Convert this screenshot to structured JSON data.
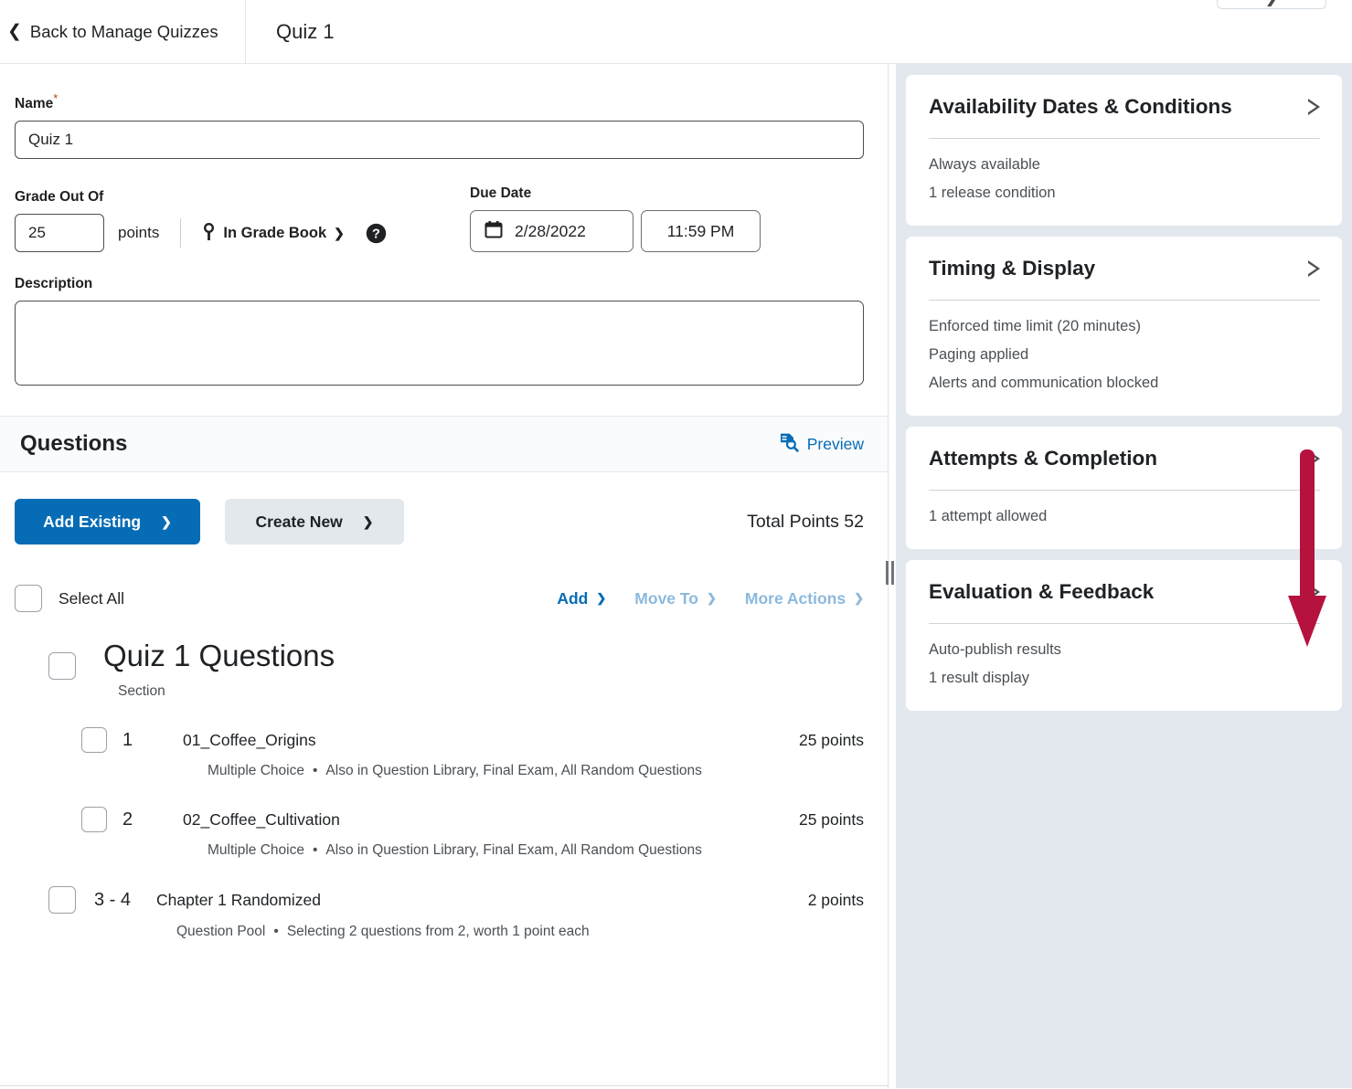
{
  "topbar": {
    "back_label": "Back to Manage Quizzes",
    "back_icon": "chevron-left-icon",
    "doc_title": "Quiz 1",
    "partial_dropdown_icon": "chevron-down-icon"
  },
  "form": {
    "name_label": "Name",
    "name_required_marker": "*",
    "name_value": "Quiz 1",
    "name_placeholder": "",
    "grade_label": "Grade Out Of",
    "grade_value": "25",
    "grade_units": "points",
    "gradebook_icon": "key-icon",
    "gradebook_label": "In Grade Book",
    "gradebook_chevron": "chevron-down-icon",
    "help_icon": "question-circle-icon",
    "due_label": "Due Date",
    "due_date_icon": "calendar-icon",
    "due_date_value": "2/28/2022",
    "due_time_value": "11:59 PM",
    "description_label": "Description",
    "description_value": "",
    "description_placeholder": ""
  },
  "questions": {
    "heading": "Questions",
    "preview_label": "Preview",
    "preview_icon": "document-search-icon",
    "add_existing_label": "Add Existing",
    "create_new_label": "Create New",
    "dropdown_icon": "chevron-down-icon",
    "total_points_label": "Total Points 52",
    "select_all_label": "Select All",
    "tools": [
      {
        "label": "Add",
        "state": "enabled"
      },
      {
        "label": "Move To",
        "state": "disabled"
      },
      {
        "label": "More Actions",
        "state": "disabled"
      }
    ],
    "section": {
      "title": "Quiz 1 Questions",
      "subtitle": "Section"
    },
    "items": [
      {
        "number": "1",
        "name": "01_Coffee_Origins",
        "points": "25 points",
        "type": "Multiple Choice",
        "detail": "Also in Question Library, Final Exam, All Random Questions"
      },
      {
        "number": "2",
        "name": "02_Coffee_Cultivation",
        "points": "25 points",
        "type": "Multiple Choice",
        "detail": "Also in Question Library, Final Exam, All Random Questions"
      },
      {
        "number": "3 - 4",
        "name": "Chapter 1 Randomized",
        "points": "2 points",
        "type": "Question Pool",
        "detail": "Selecting 2 questions from 2, worth 1 point each"
      }
    ],
    "meta_separator": "•"
  },
  "panel": {
    "cards": [
      {
        "title": "Availability Dates & Conditions",
        "expand_icon": "triangle-right-icon",
        "lines": [
          "Always available",
          "1 release condition"
        ]
      },
      {
        "title": "Timing & Display",
        "expand_icon": "triangle-right-icon",
        "lines": [
          "Enforced time limit (20 minutes)",
          "Paging applied",
          "Alerts and communication blocked"
        ]
      },
      {
        "title": "Attempts & Completion",
        "expand_icon": "triangle-right-icon",
        "lines": [
          "1 attempt allowed"
        ]
      },
      {
        "title": "Evaluation & Feedback",
        "expand_icon": "triangle-right-icon",
        "lines": [
          "Auto-publish results",
          "1 result display"
        ]
      }
    ]
  },
  "annotation": {
    "arrow_color": "#b5123d",
    "arrow_direction": "down"
  },
  "colors": {
    "primary_blue": "#066cb5",
    "disabled_blue": "#8cb9dd",
    "panel_background": "#e3e8ef",
    "secondary_button": "#e3e8ed"
  }
}
